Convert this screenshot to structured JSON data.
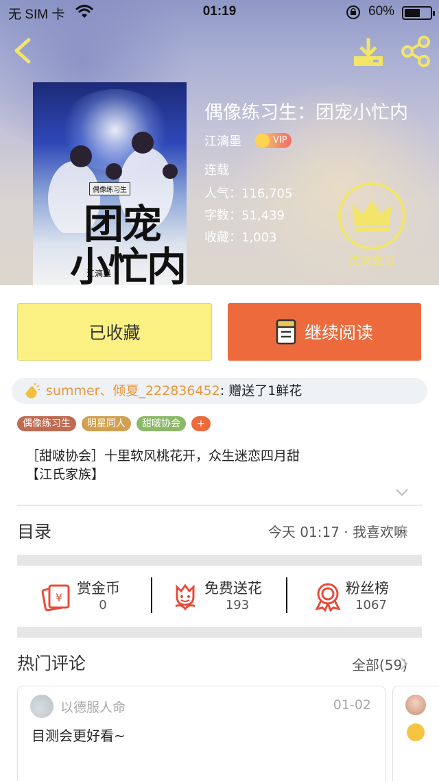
{
  "status_bar": {
    "carrier": "无 SIM 卡",
    "time": "01:19",
    "battery_pct": "60%",
    "battery_level": 0.6
  },
  "nav": {
    "back_icon": "chevron-left-icon",
    "download_icon": "download-icon",
    "share_icon": "share-icon",
    "icon_color": "#f2e56a"
  },
  "cover": {
    "series_tag": "偶像练习生",
    "title_line1": "团宠",
    "title_line2": "小忙内",
    "author": "江漓墨"
  },
  "book": {
    "title": "偶像练习生：团宠小忙内",
    "author": "江漓墨",
    "vip_label": "VIP",
    "status": "连载",
    "popularity": "人气：116,705",
    "word_count": "字数：51,439",
    "favorites": "收藏：1,003"
  },
  "vip_join": {
    "label": "点亮会员",
    "icon": "crown-icon"
  },
  "actions": {
    "favorited_label": "已收藏",
    "continue_label": "继续阅读"
  },
  "gift_bar": {
    "senders": "summer、倾夏_222836452",
    "message": ": 赠送了1鲜花"
  },
  "tags": [
    {
      "label": "偶像练习生",
      "color": "#c06a50"
    },
    {
      "label": "明星同人",
      "color": "#d2a050"
    },
    {
      "label": "甜啵协会",
      "color": "#8cb86a"
    }
  ],
  "tag_add": "+",
  "intro": {
    "line1": "［甜啵协会］十里软风桃花开，众生迷恋四月甜",
    "line2": "【江氏家族】"
  },
  "toc": {
    "title": "目录",
    "latest": "今天 01:17 · 我喜欢嘛"
  },
  "stats": [
    {
      "title": "赏金币",
      "value": "0",
      "icon": "reward-icon"
    },
    {
      "title": "免费送花",
      "value": "193",
      "icon": "flower-icon"
    },
    {
      "title": "粉丝榜",
      "value": "1067",
      "icon": "medal-icon"
    }
  ],
  "comments": {
    "title": "热门评论",
    "all_label": "全部(59)",
    "items": [
      {
        "user": "以德服人命",
        "date": "01-02",
        "text": "目测会更好看~"
      }
    ]
  },
  "colors": {
    "accent_orange": "#ec6a3c",
    "fav_yellow": "#fbf183",
    "icon_red": "#e84b3a"
  }
}
